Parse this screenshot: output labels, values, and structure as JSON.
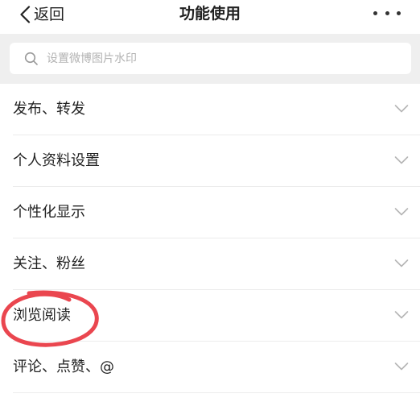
{
  "header": {
    "back_label": "返回",
    "title": "功能使用",
    "back_icon": "chevron-left-icon",
    "more_icon": "more-horizontal-icon"
  },
  "search": {
    "placeholder": "设置微博图片水印",
    "value": "",
    "icon": "search-icon"
  },
  "menu": {
    "items": [
      {
        "label": "发布、转发"
      },
      {
        "label": "个人资料设置"
      },
      {
        "label": "个性化显示"
      },
      {
        "label": "关注、粉丝"
      },
      {
        "label": "浏览阅读"
      },
      {
        "label": "评论、点赞、@"
      }
    ],
    "expand_icon": "chevron-down-icon"
  },
  "annotation": {
    "type": "hand-drawn circle",
    "target": "浏览阅读",
    "color": "#e8323c"
  },
  "colors": {
    "text": "#222222",
    "chevron": "#b5b5b5",
    "search_band": "#efefef",
    "placeholder": "#b3b3b3",
    "divider": "#ececec",
    "background": "#ffffff"
  }
}
